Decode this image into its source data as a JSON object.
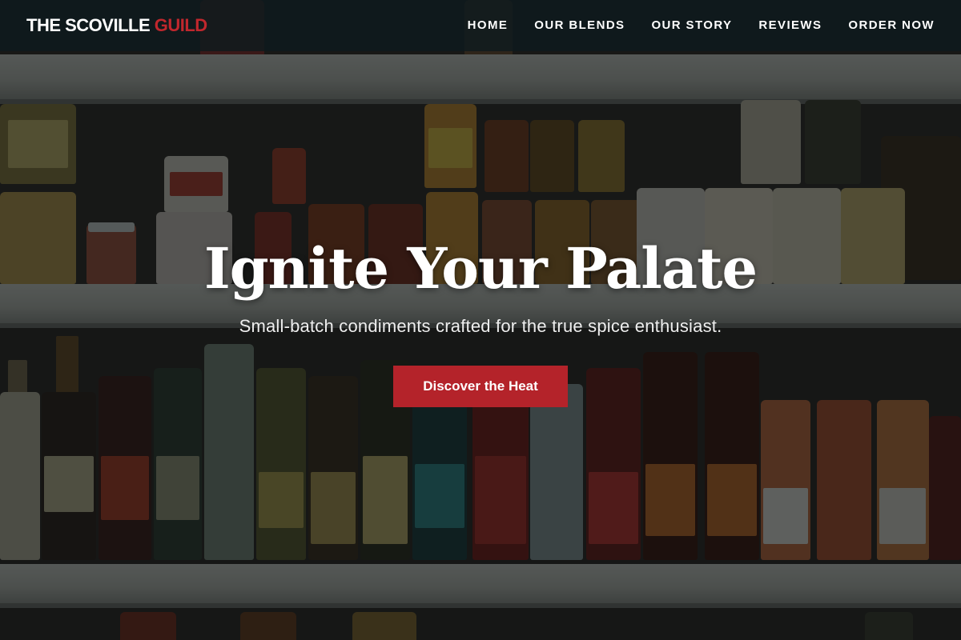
{
  "brand": {
    "name_primary": "THE SCOVILLE",
    "name_accent": "GUILD",
    "accent_color": "#c0272d"
  },
  "nav": {
    "items": [
      {
        "label": "HOME"
      },
      {
        "label": "OUR BLENDS"
      },
      {
        "label": "OUR STORY"
      },
      {
        "label": "REVIEWS"
      },
      {
        "label": "ORDER NOW"
      }
    ]
  },
  "hero": {
    "title": "Ignite Your Palate",
    "subtitle": "Small-batch condiments crafted for the true spice enthusiast.",
    "cta_label": "Discover the Heat",
    "cta_color": "#b4232a",
    "background": "photo of store shelves stocked with sauce jars and bottles (darkened overlay)"
  }
}
